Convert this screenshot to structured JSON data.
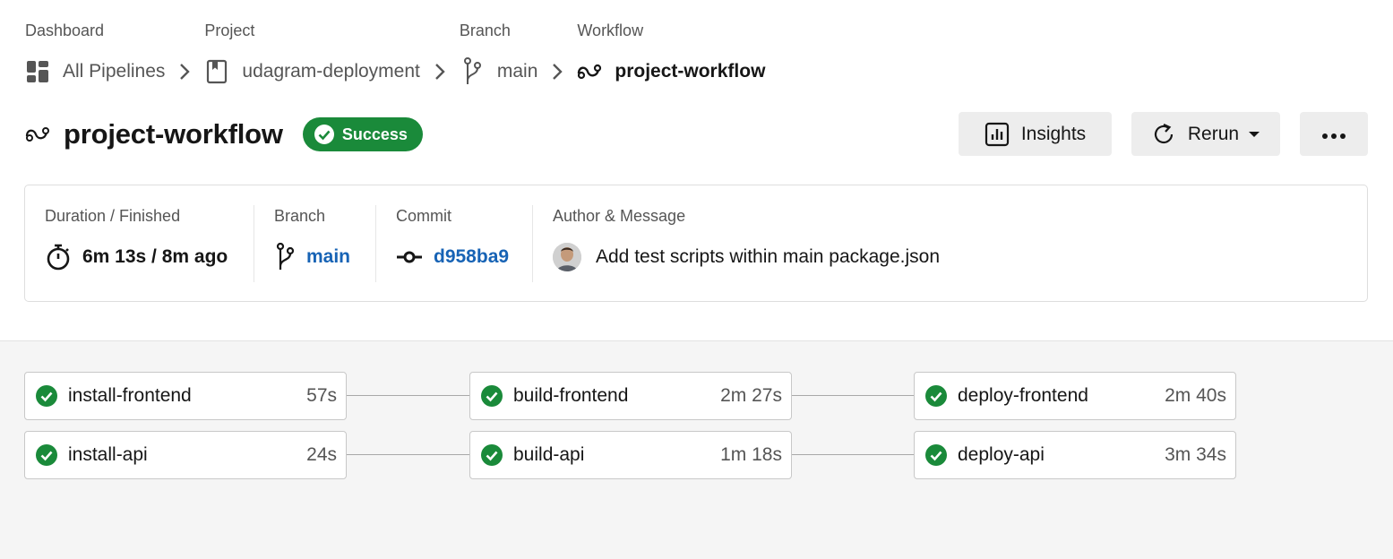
{
  "breadcrumb": [
    {
      "label": "Dashboard",
      "text": "All Pipelines",
      "icon": "dashboard-icon"
    },
    {
      "label": "Project",
      "text": "udagram-deployment",
      "icon": "repository-icon"
    },
    {
      "label": "Branch",
      "text": "main",
      "icon": "branch-icon"
    },
    {
      "label": "Workflow",
      "text": "project-workflow",
      "icon": "workflow-icon"
    }
  ],
  "header": {
    "title": "project-workflow",
    "status": "Success",
    "status_color": "#1a8a3a"
  },
  "actions": {
    "insights": "Insights",
    "rerun": "Rerun",
    "more_icon": "ellipsis-icon"
  },
  "info": {
    "duration_label": "Duration / Finished",
    "duration_value": "6m 13s / 8m ago",
    "branch_label": "Branch",
    "branch_value": "main",
    "commit_label": "Commit",
    "commit_value": "d958ba9",
    "author_label": "Author & Message",
    "message": "Add test scripts within main package.json",
    "link_color": "#1763b5"
  },
  "jobs": [
    {
      "name": "install-frontend",
      "duration": "57s",
      "status": "success"
    },
    {
      "name": "build-frontend",
      "duration": "2m 27s",
      "status": "success"
    },
    {
      "name": "deploy-frontend",
      "duration": "2m 40s",
      "status": "success"
    },
    {
      "name": "install-api",
      "duration": "24s",
      "status": "success"
    },
    {
      "name": "build-api",
      "duration": "1m 18s",
      "status": "success"
    },
    {
      "name": "deploy-api",
      "duration": "3m 34s",
      "status": "success"
    }
  ]
}
